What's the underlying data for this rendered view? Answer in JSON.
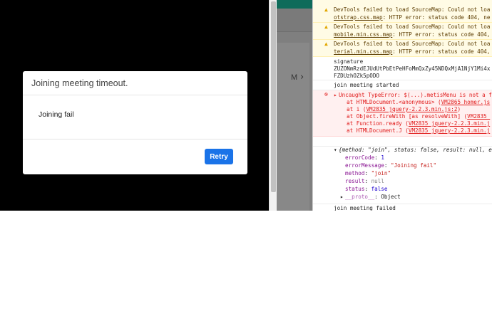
{
  "modal": {
    "title": "Joining meeting timeout.",
    "body": "Joining fail",
    "retry_label": "Retry"
  },
  "background_app": {
    "letter": "M",
    "chevron": "›"
  },
  "console": {
    "warnings": [
      {
        "line1": "DevTools failed to load SourceMap: Could not loa",
        "line2_link": "otstrap.css.map",
        "line2_rest": ": HTTP error: status code 404, ne"
      },
      {
        "line1": "DevTools failed to load SourceMap: Could not loa",
        "line2_link": "mobile.min.css.map",
        "line2_rest": ": HTTP error: status code 404,"
      },
      {
        "line1": "DevTools failed to load SourceMap: Could not loa",
        "line2_link": "terial.min.css.map",
        "line2_rest": ": HTTP error: status code 404,"
      }
    ],
    "signature_label": "signature",
    "signature_line1": "ZUZONmRzdEJUdUtPbEtPeHFoMmQxZy45NDQxMjA1NjY1Mi4x",
    "signature_line2": "FZDUzhOZk5pODO",
    "join_started": "join meeting started",
    "error": {
      "message": "Uncaught TypeError: $(...).metisMenu is not a f",
      "frames": [
        {
          "prefix": "at HTMLDocument.<anonymous> (",
          "link": "VM2865 homer.js"
        },
        {
          "prefix": "at i (",
          "link": "VM2835 jquery-2.2.3.min.js:2",
          "suffix": ")"
        },
        {
          "prefix": "at Object.fireWith [as resolveWith] (",
          "link": "VM2835_"
        },
        {
          "prefix": "at Function.ready (",
          "link": "VM2835 jquery-2.2.3.min.j"
        },
        {
          "prefix": "at HTMLDocument.J (",
          "link": "VM2835 jquery-2.2.3.min.j"
        }
      ]
    },
    "object": {
      "summary_prefix": "{",
      "summary": "method: \"join\", status: false, result: null, e",
      "props": [
        {
          "key": "errorCode",
          "value": "1",
          "kind": "num"
        },
        {
          "key": "errorMessage",
          "value": "\"Joining fail\"",
          "kind": "str"
        },
        {
          "key": "method",
          "value": "\"join\"",
          "kind": "str"
        },
        {
          "key": "result",
          "value": "null",
          "kind": "gray"
        },
        {
          "key": "status",
          "value": "false",
          "kind": "num"
        }
      ],
      "proto_key": "__proto__",
      "proto_value": "Object"
    },
    "join_failed": "join meeting failed"
  },
  "colors": {
    "retry_button": "#1a73e8",
    "warning_bg": "#fffbe5",
    "error_text": "#e01a1a",
    "error_bg": "#fff0f0"
  }
}
